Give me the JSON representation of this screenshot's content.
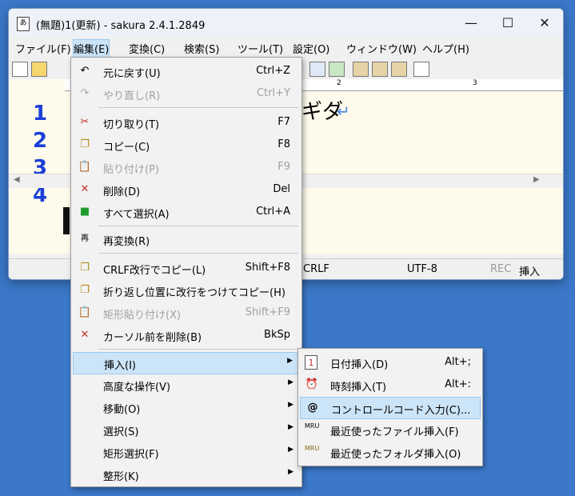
{
  "window": {
    "title": "(無題)1(更新) - sakura 2.4.1.2849",
    "minimize": "—",
    "maximize": "☐",
    "close": "✕"
  },
  "menubar": [
    "ファイル(F)",
    "編集(E)",
    "変換(C)",
    "検索(S)",
    "ツール(T)",
    "設定(O)",
    "ウィンドウ(W)",
    "ヘルプ(H)"
  ],
  "ruler": {
    "mark2": "2",
    "mark3": "3"
  },
  "editor": {
    "line_numbers": [
      "1",
      "2",
      "3",
      "4"
    ],
    "visible_text": "ギダ"
  },
  "status": {
    "eol": "CRLF",
    "encoding": "UTF-8",
    "rec": "REC",
    "mode": "挿入"
  },
  "edit_menu": [
    {
      "label": "元に戻す(U)",
      "shortcut": "Ctrl+Z",
      "icon": "undo-icon",
      "disabled": false
    },
    {
      "label": "やり直し(R)",
      "shortcut": "Ctrl+Y",
      "icon": "redo-icon",
      "disabled": true
    },
    {
      "label": "切り取り(T)",
      "shortcut": "F7",
      "icon": "scissors-icon",
      "disabled": false
    },
    {
      "label": "コピー(C)",
      "shortcut": "F8",
      "icon": "copy-icon",
      "disabled": false
    },
    {
      "label": "貼り付け(P)",
      "shortcut": "F9",
      "icon": "paste-icon",
      "disabled": true
    },
    {
      "label": "削除(D)",
      "shortcut": "Del",
      "icon": "delete-icon",
      "disabled": false
    },
    {
      "label": "すべて選択(A)",
      "shortcut": "Ctrl+A",
      "icon": "select-all-icon",
      "disabled": false
    },
    {
      "label": "再変換(R)",
      "shortcut": "",
      "icon": "reconvert-icon",
      "disabled": false
    },
    {
      "label": "CRLF改行でコピー(L)",
      "shortcut": "Shift+F8",
      "icon": "crlf-copy-icon",
      "disabled": false
    },
    {
      "label": "折り返し位置に改行をつけてコピー(H)",
      "shortcut": "",
      "icon": "wrap-copy-icon",
      "disabled": false
    },
    {
      "label": "矩形貼り付け(X)",
      "shortcut": "Shift+F9",
      "icon": "box-paste-icon",
      "disabled": true
    },
    {
      "label": "カーソル前を削除(B)",
      "shortcut": "BkSp",
      "icon": "backspace-icon",
      "disabled": false
    },
    {
      "label": "挿入(I)",
      "shortcut": "",
      "icon": "",
      "disabled": false
    },
    {
      "label": "高度な操作(V)",
      "shortcut": "",
      "icon": "",
      "disabled": false
    },
    {
      "label": "移動(O)",
      "shortcut": "",
      "icon": "",
      "disabled": false
    },
    {
      "label": "選択(S)",
      "shortcut": "",
      "icon": "",
      "disabled": false
    },
    {
      "label": "矩形選択(F)",
      "shortcut": "",
      "icon": "",
      "disabled": false
    },
    {
      "label": "整形(K)",
      "shortcut": "",
      "icon": "",
      "disabled": false
    }
  ],
  "insert_menu": [
    {
      "label": "日付挿入(D)",
      "shortcut": "Alt+;",
      "icon": "calendar-icon"
    },
    {
      "label": "時刻挿入(T)",
      "shortcut": "Alt+:",
      "icon": "clock-icon"
    },
    {
      "label": "コントロールコード入力(C)...",
      "shortcut": "",
      "icon": "control-code-icon"
    },
    {
      "label": "最近使ったファイル挿入(F)",
      "shortcut": "",
      "icon": "mru-file-icon"
    },
    {
      "label": "最近使ったフォルダ挿入(O)",
      "shortcut": "",
      "icon": "mru-folder-icon"
    }
  ]
}
